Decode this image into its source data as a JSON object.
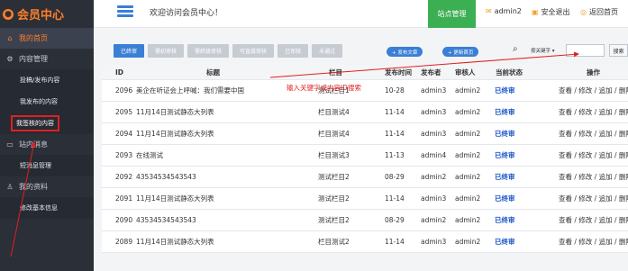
{
  "sidebar": {
    "logo": "会员中心",
    "items": [
      {
        "label": "我的首页",
        "type": "section",
        "active": true
      },
      {
        "label": "内容管理",
        "type": "section"
      },
      {
        "label": "投稿/发布内容",
        "type": "sub"
      },
      {
        "label": "我发布的内容",
        "type": "sub"
      },
      {
        "label": "我签核的内容",
        "type": "sub",
        "highlighted": true
      },
      {
        "label": "站内消息",
        "type": "section"
      },
      {
        "label": "短消息管理",
        "type": "sub"
      },
      {
        "label": "我的资料",
        "type": "section"
      },
      {
        "label": "修改基本信息",
        "type": "sub"
      }
    ]
  },
  "header": {
    "welcome": "欢迎访问会员中心！",
    "site_manage": "站点管理",
    "user": "admin2",
    "logout": "安全退出",
    "home": "返回首页"
  },
  "toolbar": {
    "tabs": [
      "已终审",
      "需初审核",
      "需终级审核",
      "可直接审核",
      "已审核",
      "未通过"
    ],
    "publish_article": "+ 发布文章",
    "update_home": "+ 更新首页",
    "keyword_select": "按关键字 ▾",
    "search_placeholder": "",
    "search_button": "搜索"
  },
  "annotation": "输入关键字或内容ID搜索",
  "table": {
    "headers": {
      "id": "ID",
      "title": "标题",
      "column": "栏目",
      "time": "发布时间",
      "publisher": "发布者",
      "reviewer": "审核人",
      "status": "当前状态",
      "ops": "操作"
    },
    "ops_text": "查看 / 修改 / 追加 / 删除 / 上",
    "rows": [
      {
        "id": "2096",
        "title": "美企在听证会上呼喊：我们需要中国",
        "column": "测试栏目1",
        "time": "10-28",
        "publisher": "admin3",
        "reviewer": "admin2",
        "status": "已终审"
      },
      {
        "id": "2095",
        "title": "11月14日测试静态大列表",
        "column": "栏目测试4",
        "time": "11-14",
        "publisher": "admin3",
        "reviewer": "admin2",
        "status": "已终审"
      },
      {
        "id": "2094",
        "title": "11月14日测试静态大列表",
        "column": "栏目测试4",
        "time": "11-14",
        "publisher": "admin3",
        "reviewer": "admin2",
        "status": "已终审"
      },
      {
        "id": "2093",
        "title": "在线测试",
        "column": "栏目测试3",
        "time": "11-13",
        "publisher": "admin4",
        "reviewer": "admin2",
        "status": "已终审"
      },
      {
        "id": "2092",
        "title": "43534534543543",
        "column": "测试栏目2",
        "time": "08-29",
        "publisher": "admin2",
        "reviewer": "admin2",
        "status": "已终审"
      },
      {
        "id": "2091",
        "title": "11月14日测试静态大列表",
        "column": "测试栏目2",
        "time": "11-14",
        "publisher": "admin3",
        "reviewer": "admin2",
        "status": "已终审"
      },
      {
        "id": "2090",
        "title": "43534534543543",
        "column": "测试栏目2",
        "time": "08-29",
        "publisher": "admin2",
        "reviewer": "admin2",
        "status": "已终审"
      },
      {
        "id": "2089",
        "title": "11月14日测试静态大列表",
        "column": "栏目测试2",
        "time": "11-14",
        "publisher": "admin3",
        "reviewer": "admin2",
        "status": "已终审"
      }
    ]
  }
}
